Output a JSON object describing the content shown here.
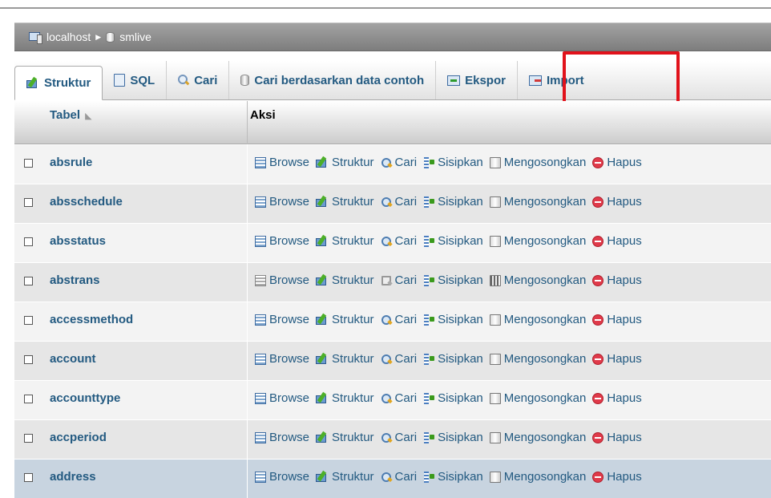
{
  "breadcrumb": {
    "server": "localhost",
    "database": "smlive"
  },
  "tabs": [
    {
      "label": "Struktur",
      "icon": "struktur-icon",
      "active": true
    },
    {
      "label": "SQL",
      "icon": "sql-icon"
    },
    {
      "label": "Cari",
      "icon": "search-icon"
    },
    {
      "label": "Cari berdasarkan data contoh",
      "icon": "database-icon"
    },
    {
      "label": "Ekspor",
      "icon": "export-icon",
      "highlighted": true
    },
    {
      "label": "Import",
      "icon": "import-icon"
    }
  ],
  "table": {
    "headers": {
      "tabel": "Tabel",
      "aksi": "Aksi"
    },
    "actions": {
      "browse": "Browse",
      "struktur": "Struktur",
      "cari": "Cari",
      "sisipkan": "Sisipkan",
      "mengosongkan": "Mengosongkan",
      "hapus": "Hapus"
    },
    "rows": [
      {
        "name": "absrule"
      },
      {
        "name": "absschedule"
      },
      {
        "name": "absstatus"
      },
      {
        "name": "abstrans",
        "empty": true
      },
      {
        "name": "accessmethod"
      },
      {
        "name": "account"
      },
      {
        "name": "accounttype"
      },
      {
        "name": "accperiod"
      },
      {
        "name": "address",
        "selected": true
      }
    ]
  },
  "colors": {
    "link": "#235a81",
    "highlight_box": "#e1121b",
    "hapus": "#e03a4a"
  }
}
